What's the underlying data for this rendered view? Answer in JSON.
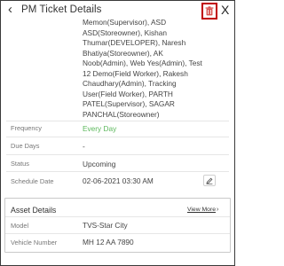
{
  "header": {
    "back_icon": "chevron-left-icon",
    "title": "PM Ticket Details",
    "delete_icon": "trash-icon",
    "close_label": "X"
  },
  "assignees": [
    "Memon(Supervisor), ASD",
    "ASD(Storeowner), Kishan",
    "Thumar(DEVELOPER), Naresh",
    "Bhatiya(Storeowner), AK",
    "Noob(Admin), Web Yes(Admin), Test",
    "12 Demo(Field Worker), Rakesh",
    "Chaudhary(Admin), Tracking",
    "User(Field Worker), PARTH",
    "PATEL(Supervisor), SAGAR",
    "PANCHAL(Storeowner)"
  ],
  "details": {
    "frequency_label": "Frequency",
    "frequency_value": "Every Day",
    "due_days_label": "Due Days",
    "due_days_value": "-",
    "status_label": "Status",
    "status_value": "Upcoming",
    "schedule_date_label": "Schedule Date",
    "schedule_date_value": "02-06-2021 03:30 AM",
    "edit_icon": "pencil-icon"
  },
  "asset": {
    "title": "Asset Details",
    "view_more_label": "View More",
    "model_label": "Model",
    "model_value": "TVS-Star City",
    "vehicle_number_label": "Vehicle Number",
    "vehicle_number_value": "MH 12 AA 7890"
  },
  "colors": {
    "delete_border": "#c00000",
    "frequency_value": "#5cb85c",
    "label_text": "#777777",
    "value_text": "#444444"
  }
}
